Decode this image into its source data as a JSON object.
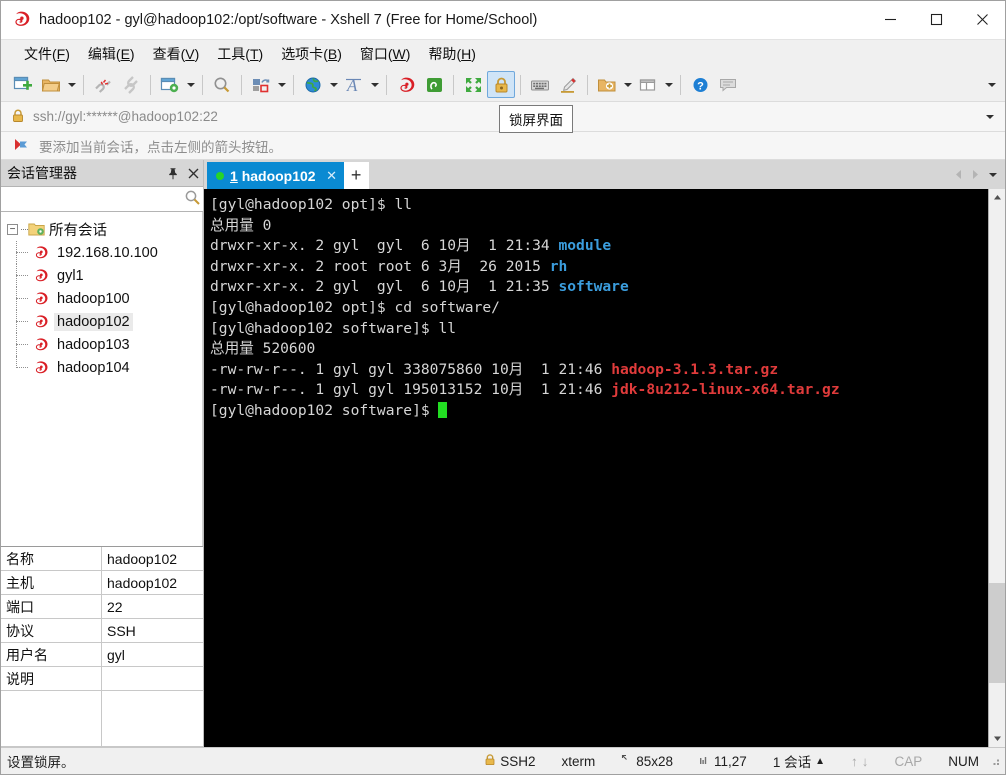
{
  "window": {
    "title": "hadoop102 - gyl@hadoop102:/opt/software - Xshell 7 (Free for Home/School)",
    "logo_icon": "xshell-logo-icon",
    "minimize_label": "─",
    "maximize_label": "☐",
    "close_label": "✕"
  },
  "menubar": {
    "items": [
      {
        "text": "文件",
        "accel": "F"
      },
      {
        "text": "编辑",
        "accel": "E"
      },
      {
        "text": "查看",
        "accel": "V"
      },
      {
        "text": "工具",
        "accel": "T"
      },
      {
        "text": "选项卡",
        "accel": "B"
      },
      {
        "text": "窗口",
        "accel": "W"
      },
      {
        "text": "帮助",
        "accel": "H"
      }
    ]
  },
  "toolbar": {
    "buttons": [
      {
        "name": "new-session-icon",
        "has_arrow": false
      },
      {
        "name": "open-folder-icon",
        "has_arrow": true
      },
      {
        "name": "disconnect-icon",
        "has_arrow": false
      },
      {
        "name": "reconnect-icon",
        "has_arrow": false
      },
      {
        "name": "session-properties-icon",
        "has_arrow": true
      },
      {
        "name": "find-icon",
        "has_arrow": false
      },
      {
        "name": "file-transfer-icon",
        "has_arrow": true
      },
      {
        "name": "encoding-globe-icon",
        "has_arrow": true
      },
      {
        "name": "font-icon",
        "has_arrow": true
      },
      {
        "name": "xshell-icon",
        "has_arrow": false
      },
      {
        "name": "xftp-icon",
        "has_arrow": false
      },
      {
        "name": "fullscreen-icon",
        "has_arrow": false
      },
      {
        "name": "lock-screen-icon",
        "has_arrow": false
      },
      {
        "name": "keyboard-icon",
        "has_arrow": false
      },
      {
        "name": "highlight-icon",
        "has_arrow": false
      },
      {
        "name": "new-folder-icon",
        "has_arrow": true
      },
      {
        "name": "layout-icon",
        "has_arrow": true
      },
      {
        "name": "help-icon",
        "has_arrow": false
      },
      {
        "name": "chat-icon",
        "has_arrow": false
      }
    ],
    "overflow_icon": "toolbar-overflow-icon"
  },
  "tooltip": {
    "text": "锁屏界面"
  },
  "address_bar": {
    "lock_icon": "lock-icon",
    "url": "ssh://gyl:******@hadoop102:22",
    "dropdown_icon": "chevron-down-icon"
  },
  "notice": {
    "icon": "arrow-hint-icon",
    "text": "要添加当前会话，点击左侧的箭头按钮。"
  },
  "session_panel": {
    "title": "会话管理器",
    "pin_icon": "pin-icon",
    "close_icon": "close-icon",
    "search": {
      "value": "",
      "placeholder": "",
      "icon": "search-icon"
    },
    "tree": {
      "root": {
        "label": "所有会话",
        "icon": "folder-sessions-icon",
        "expander": "−"
      },
      "items": [
        {
          "label": "192.168.10.100",
          "icon": "session-icon",
          "selected": false
        },
        {
          "label": "gyl1",
          "icon": "session-icon",
          "selected": false
        },
        {
          "label": "hadoop100",
          "icon": "session-icon",
          "selected": false
        },
        {
          "label": "hadoop102",
          "icon": "session-icon",
          "selected": true
        },
        {
          "label": "hadoop103",
          "icon": "session-icon",
          "selected": false
        },
        {
          "label": "hadoop104",
          "icon": "session-icon",
          "selected": false
        }
      ]
    },
    "properties": [
      {
        "key": "名称",
        "value": "hadoop102"
      },
      {
        "key": "主机",
        "value": "hadoop102"
      },
      {
        "key": "端口",
        "value": "22"
      },
      {
        "key": "协议",
        "value": "SSH"
      },
      {
        "key": "用户名",
        "value": "gyl"
      },
      {
        "key": "说明",
        "value": ""
      },
      {
        "key": "",
        "value": ""
      }
    ]
  },
  "tabs": {
    "items": [
      {
        "index": "1",
        "label": "hadoop102",
        "active": true,
        "status_dot": "#27d427",
        "close_label": "✕"
      }
    ],
    "add_label": "+",
    "prev_icon": "chevron-left-icon",
    "next_icon": "chevron-right-icon",
    "menu_icon": "chevron-down-icon"
  },
  "terminal": {
    "lines": [
      [
        {
          "t": "[gyl@hadoop102 opt]$ ll",
          "c": "w"
        }
      ],
      [
        {
          "t": "总用量 0",
          "c": "w"
        }
      ],
      [
        {
          "t": "drwxr-xr-x. 2 gyl  gyl  6 10月  1 21:34 ",
          "c": "w"
        },
        {
          "t": "module",
          "c": "b"
        }
      ],
      [
        {
          "t": "drwxr-xr-x. 2 root root 6 3月  26 2015 ",
          "c": "w"
        },
        {
          "t": "rh",
          "c": "b"
        }
      ],
      [
        {
          "t": "drwxr-xr-x. 2 gyl  gyl  6 10月  1 21:35 ",
          "c": "w"
        },
        {
          "t": "software",
          "c": "b"
        }
      ],
      [
        {
          "t": "[gyl@hadoop102 opt]$ cd software/",
          "c": "w"
        }
      ],
      [
        {
          "t": "[gyl@hadoop102 software]$ ll",
          "c": "w"
        }
      ],
      [
        {
          "t": "总用量 520600",
          "c": "w"
        }
      ],
      [
        {
          "t": "-rw-rw-r--. 1 gyl gyl 338075860 10月  1 21:46 ",
          "c": "w"
        },
        {
          "t": "hadoop-3.1.3.tar.gz",
          "c": "r"
        }
      ],
      [
        {
          "t": "-rw-rw-r--. 1 gyl gyl 195013152 10月  1 21:46 ",
          "c": "w"
        },
        {
          "t": "jdk-8u212-linux-x64.tar.gz",
          "c": "r"
        }
      ],
      [
        {
          "t": "[gyl@hadoop102 software]$ ",
          "c": "w"
        },
        {
          "t": "",
          "c": "cursor"
        }
      ]
    ],
    "scrollbar": {
      "up_icon": "scroll-up-icon",
      "down_icon": "scroll-down-icon"
    }
  },
  "statusbar": {
    "message": "设置锁屏。",
    "protocol_icon": "lock-icon",
    "protocol": "SSH2",
    "term_type": "xterm",
    "size_icon": "size-icon",
    "size": "85x28",
    "pos_icon": "cursor-pos-icon",
    "position": "11,27",
    "sessions": "1 会话",
    "sessions_caret": "▲",
    "transfer_up": "↑",
    "transfer_down": "↓",
    "caps": "CAP",
    "num": "NUM"
  },
  "colors": {
    "accent": "#0a8ad2",
    "terminal_bg": "#000000",
    "terminal_fg": "#d6d6d6",
    "dir_blue": "#3b9ddd",
    "archive_red": "#e03b3b",
    "cursor_green": "#22dd22"
  }
}
